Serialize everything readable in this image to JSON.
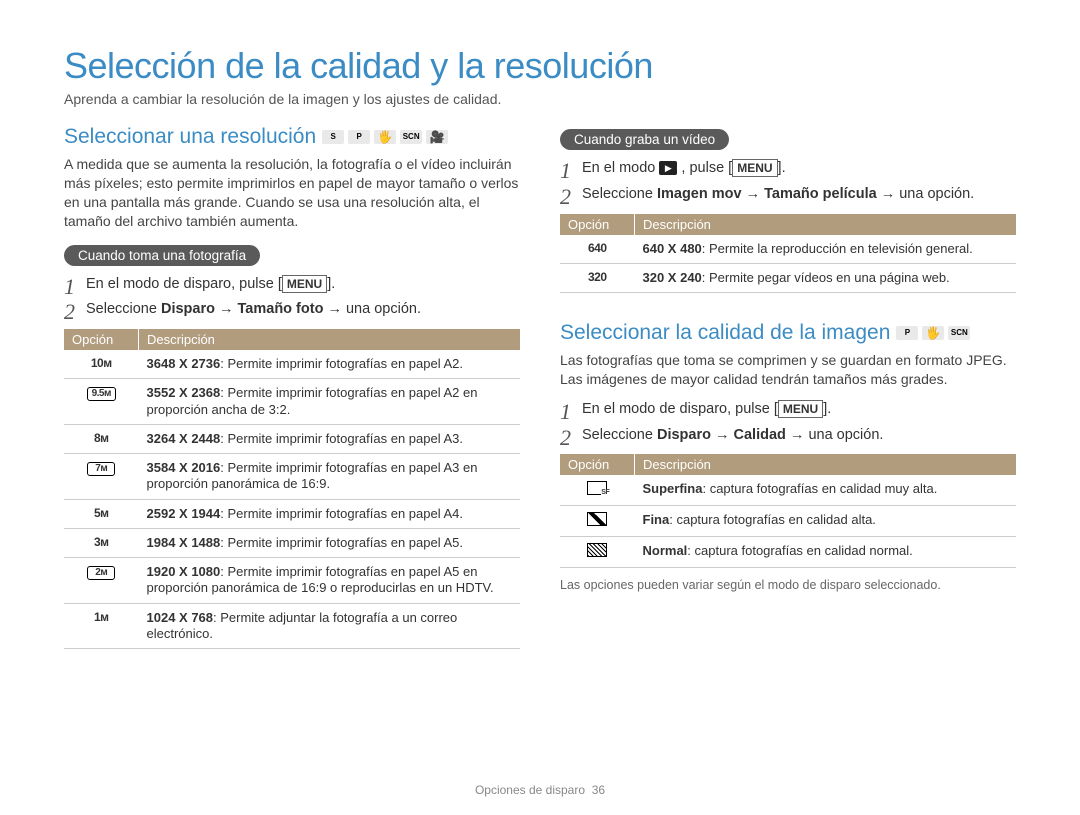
{
  "page": {
    "title": "Selección de la calidad y la resolución",
    "intro": "Aprenda a cambiar la resolución de la imagen y los ajustes de calidad.",
    "footer_label": "Opciones de disparo",
    "footer_page": "36"
  },
  "left": {
    "subhead": "Seleccionar una resolución",
    "body": "A medida que se aumenta la resolución, la fotografía o el vídeo incluirán más píxeles; esto permite imprimirlos en papel de mayor tamaño o verlos en una pantalla más grande. Cuando se usa una resolución alta, el tamaño del archivo también aumenta.",
    "pill_photo": "Cuando toma una fotografía",
    "step1_a": "En el modo de disparo, pulse [",
    "step1_menu": "MENU",
    "step1_b": "].",
    "step2_a": "Seleccione ",
    "step2_bold": "Disparo → Tamaño foto →",
    "step2_b": " una opción.",
    "table_head_opt": "Opción",
    "table_head_desc": "Descripción",
    "photo_rows": [
      {
        "icon": "10м",
        "res": "3648 X 2736",
        "desc": ": Permite imprimir fotografías en papel A2."
      },
      {
        "icon": "9.5м",
        "res": "3552 X 2368",
        "desc": ": Permite imprimir fotografías en papel A2 en proporción ancha de 3:2."
      },
      {
        "icon": "8м",
        "res": "3264 X 2448",
        "desc": ": Permite imprimir fotografías en papel A3."
      },
      {
        "icon": "7м",
        "res": "3584 X 2016",
        "desc": ": Permite imprimir fotografías en papel A3 en proporción panorámica de 16:9."
      },
      {
        "icon": "5м",
        "res": "2592 X 1944",
        "desc": ": Permite imprimir fotografías en papel A4."
      },
      {
        "icon": "3м",
        "res": "1984 X 1488",
        "desc": ": Permite imprimir fotografías en papel A5."
      },
      {
        "icon": "2м",
        "res": "1920 X 1080",
        "desc": ": Permite imprimir fotografías en papel A5 en proporción panorámica de 16:9 o reproducirlas en un HDTV."
      },
      {
        "icon": "1м",
        "res": "1024 X 768",
        "desc": ": Permite adjuntar la fotografía a un correo electrónico."
      }
    ]
  },
  "right": {
    "pill_video": "Cuando graba un vídeo",
    "vstep1_a": "En el modo ",
    "video_icon_alt": "vídeo",
    "vstep1_b": " , pulse [",
    "vstep1_menu": "MENU",
    "vstep1_c": "].",
    "vstep2_a": "Seleccione ",
    "vstep2_bold": "Imagen mov → Tamaño película →",
    "vstep2_b": " una opción.",
    "table_head_opt": "Opción",
    "table_head_desc": "Descripción",
    "video_rows": [
      {
        "icon": "640",
        "res": "640 X 480",
        "desc": ": Permite la reproducción en televisión general."
      },
      {
        "icon": "320",
        "res": "320 X 240",
        "desc": ": Permite pegar vídeos en una página web."
      }
    ],
    "subhead2": "Seleccionar la calidad de la imagen",
    "body2": "Las fotografías que toma se comprimen y se guardan en formato JPEG. Las imágenes de mayor calidad tendrán tamaños más grades.",
    "qstep1_a": "En el modo de disparo, pulse [",
    "qstep1_menu": "MENU",
    "qstep1_b": "].",
    "qstep2_a": "Seleccione ",
    "qstep2_bold": "Disparo → Calidad →",
    "qstep2_b": " una opción.",
    "quality_rows": [
      {
        "icon_class": "sf",
        "name": "Superfina",
        "desc": ": captura fotografías en calidad muy alta."
      },
      {
        "icon_class": "f",
        "name": "Fina",
        "desc": ": captura fotografías en calidad alta."
      },
      {
        "icon_class": "n",
        "name": "Normal",
        "desc": ": captura fotografías en calidad normal."
      }
    ],
    "footnote": "Las opciones pueden variar según el modo de disparo seleccionado."
  }
}
